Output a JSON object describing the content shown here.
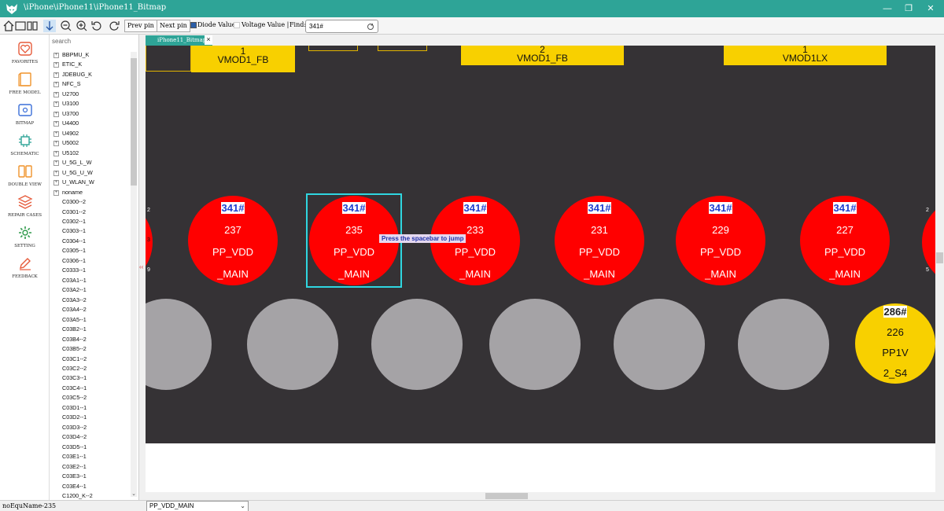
{
  "window": {
    "title": "\\iPhone\\iPhone11\\iPhone11_Bitmap",
    "controls": {
      "minimize": "—",
      "maximize": "❐",
      "close": "✕"
    },
    "accent": "#2ea497"
  },
  "toolbar": {
    "prev_pin": "Prev pin",
    "next_pin": "Next pin",
    "diode_value": "Diode Value",
    "voltage_value": "Voltage Value |",
    "find_label": "Find:",
    "find_value": "341#"
  },
  "nav": [
    {
      "id": "favorites",
      "label": "FAVORITES",
      "icon": "heart-icon"
    },
    {
      "id": "free-model",
      "label": "FREE MODEL",
      "icon": "book-icon"
    },
    {
      "id": "bitmap",
      "label": "BITMAP",
      "icon": "bitmap-icon"
    },
    {
      "id": "schematic",
      "label": "SCHEMATIC",
      "icon": "chip-icon"
    },
    {
      "id": "double-view",
      "label": "DOUBLE VIEW",
      "icon": "double-view-icon"
    },
    {
      "id": "repair-cases",
      "label": "REPAIR CASES",
      "icon": "layers-icon"
    },
    {
      "id": "setting",
      "label": "SETTING",
      "icon": "gear-icon"
    },
    {
      "id": "feedback",
      "label": "FEEDBACK",
      "icon": "edit-icon"
    }
  ],
  "tree": {
    "placeholder": "search",
    "items": [
      {
        "label": "BBPMU_K",
        "expandable": true
      },
      {
        "label": "ETIC_K",
        "expandable": true
      },
      {
        "label": "JDEBUG_K",
        "expandable": true
      },
      {
        "label": "NFC_S",
        "expandable": true
      },
      {
        "label": "U2700",
        "expandable": true
      },
      {
        "label": "U3100",
        "expandable": true
      },
      {
        "label": "U3700",
        "expandable": true
      },
      {
        "label": "U4400",
        "expandable": true
      },
      {
        "label": "U4902",
        "expandable": true
      },
      {
        "label": "U5002",
        "expandable": true
      },
      {
        "label": "U5102",
        "expandable": true
      },
      {
        "label": "U_5G_L_W",
        "expandable": true
      },
      {
        "label": "U_5G_U_W",
        "expandable": true
      },
      {
        "label": "U_WLAN_W",
        "expandable": true
      },
      {
        "label": "noname",
        "expandable": true
      },
      {
        "label": "C0300--2",
        "expandable": false
      },
      {
        "label": "C0301--2",
        "expandable": false
      },
      {
        "label": "C0302--1",
        "expandable": false
      },
      {
        "label": "C0303--1",
        "expandable": false
      },
      {
        "label": "C0304--1",
        "expandable": false
      },
      {
        "label": "C0305--1",
        "expandable": false
      },
      {
        "label": "C0306--1",
        "expandable": false
      },
      {
        "label": "C0333--1",
        "expandable": false
      },
      {
        "label": "C03A1--1",
        "expandable": false
      },
      {
        "label": "C03A2--1",
        "expandable": false
      },
      {
        "label": "C03A3--2",
        "expandable": false
      },
      {
        "label": "C03A4--2",
        "expandable": false
      },
      {
        "label": "C03A5--1",
        "expandable": false
      },
      {
        "label": "C03B2--1",
        "expandable": false
      },
      {
        "label": "C03B4--2",
        "expandable": false
      },
      {
        "label": "C03B5--2",
        "expandable": false
      },
      {
        "label": "C03C1--2",
        "expandable": false
      },
      {
        "label": "C03C2--2",
        "expandable": false
      },
      {
        "label": "C03C3--1",
        "expandable": false
      },
      {
        "label": "C03C4--1",
        "expandable": false
      },
      {
        "label": "C03C5--2",
        "expandable": false
      },
      {
        "label": "C03D1--1",
        "expandable": false
      },
      {
        "label": "C03D2--1",
        "expandable": false
      },
      {
        "label": "C03D3--2",
        "expandable": false
      },
      {
        "label": "C03D4--2",
        "expandable": false
      },
      {
        "label": "C03D5--1",
        "expandable": false
      },
      {
        "label": "C03E1--1",
        "expandable": false
      },
      {
        "label": "C03E2--1",
        "expandable": false
      },
      {
        "label": "C03E3--1",
        "expandable": false
      },
      {
        "label": "C03E4--1",
        "expandable": false
      },
      {
        "label": "C1200_K--2",
        "expandable": false
      }
    ]
  },
  "tab": {
    "label": "iPhone11_Bitmap",
    "close": "×"
  },
  "board": {
    "top_pads": [
      {
        "num": "1",
        "net": "VMOD1_FB"
      },
      {
        "num": "2",
        "net": "VMOD1_FB"
      },
      {
        "num": "1",
        "net": "VMOD1LX"
      }
    ],
    "red_pads": [
      {
        "pin": "341#",
        "n": "237",
        "net1": "PP_VDD",
        "net2": "_MAIN"
      },
      {
        "pin": "341#",
        "n": "235",
        "net1": "PP_VDD",
        "net2": "_MAIN"
      },
      {
        "pin": "341#",
        "n": "233",
        "net1": "PP_VDD",
        "net2": "_MAIN"
      },
      {
        "pin": "341#",
        "n": "231",
        "net1": "PP_VDD",
        "net2": "_MAIN"
      },
      {
        "pin": "341#",
        "n": "229",
        "net1": "PP_VDD",
        "net2": "_MAIN"
      },
      {
        "pin": "341#",
        "n": "227",
        "net1": "PP_VDD",
        "net2": "_MAIN"
      }
    ],
    "yellow_pad": {
      "pin": "286#",
      "n": "226",
      "net1": "PP1V",
      "net2": "2_S4"
    },
    "left_edge": {
      "a": "2",
      "b": "3",
      "c": "9"
    },
    "right_edge": {
      "a": "2",
      "b": "5"
    },
    "tooltip": "Press the spacebar to jump",
    "pad_red_color": "#ff0000",
    "pad_gray_color": "#a5a3a6",
    "pad_yellow_color": "#f8d000",
    "highlight_color": "#2fd6e0",
    "background_color": "#353235"
  },
  "status": {
    "left": "noEquName-235",
    "net_select": "PP_VDD_MAIN",
    "caret": "⌄"
  }
}
